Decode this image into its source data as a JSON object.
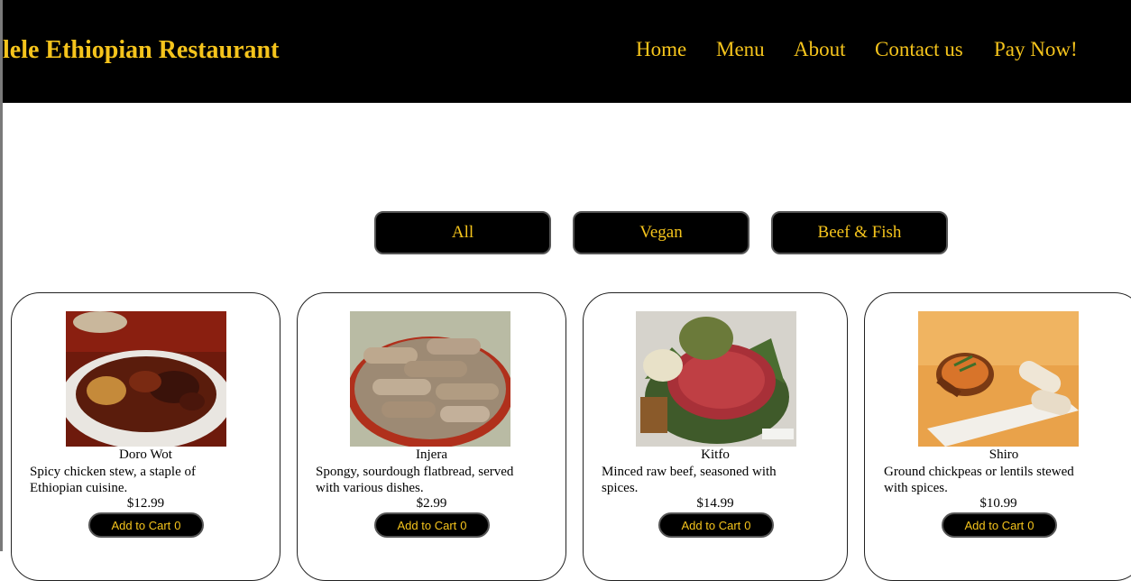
{
  "header": {
    "brand": "lele Ethiopian Restaurant",
    "nav": [
      "Home",
      "Menu",
      "About",
      "Contact us",
      "Pay Now!"
    ]
  },
  "filters": [
    "All",
    "Vegan",
    "Beef & Fish"
  ],
  "menu": [
    {
      "name": "Doro Wot",
      "desc_line1": "Spicy chicken stew, a staple of",
      "desc_line2": "Ethiopian cuisine.",
      "price": "$12.99",
      "cart_label": "Add to Cart",
      "cart_count": "0"
    },
    {
      "name": "Injera",
      "desc_line1": "Spongy, sourdough flatbread, served",
      "desc_line2": "with various dishes.",
      "price": "$2.99",
      "cart_label": "Add to Cart",
      "cart_count": "0"
    },
    {
      "name": "Kitfo",
      "desc_line1": "Minced raw beef, seasoned with",
      "desc_line2": "spices.",
      "price": "$14.99",
      "cart_label": "Add to Cart",
      "cart_count": "0"
    },
    {
      "name": "Shiro",
      "desc_line1": "Ground chickpeas or lentils stewed",
      "desc_line2": "with spices.",
      "price": "$10.99",
      "cart_label": "Add to Cart",
      "cart_count": "0"
    }
  ],
  "colors": {
    "accent": "#f5c41c",
    "header_bg": "#000000"
  }
}
